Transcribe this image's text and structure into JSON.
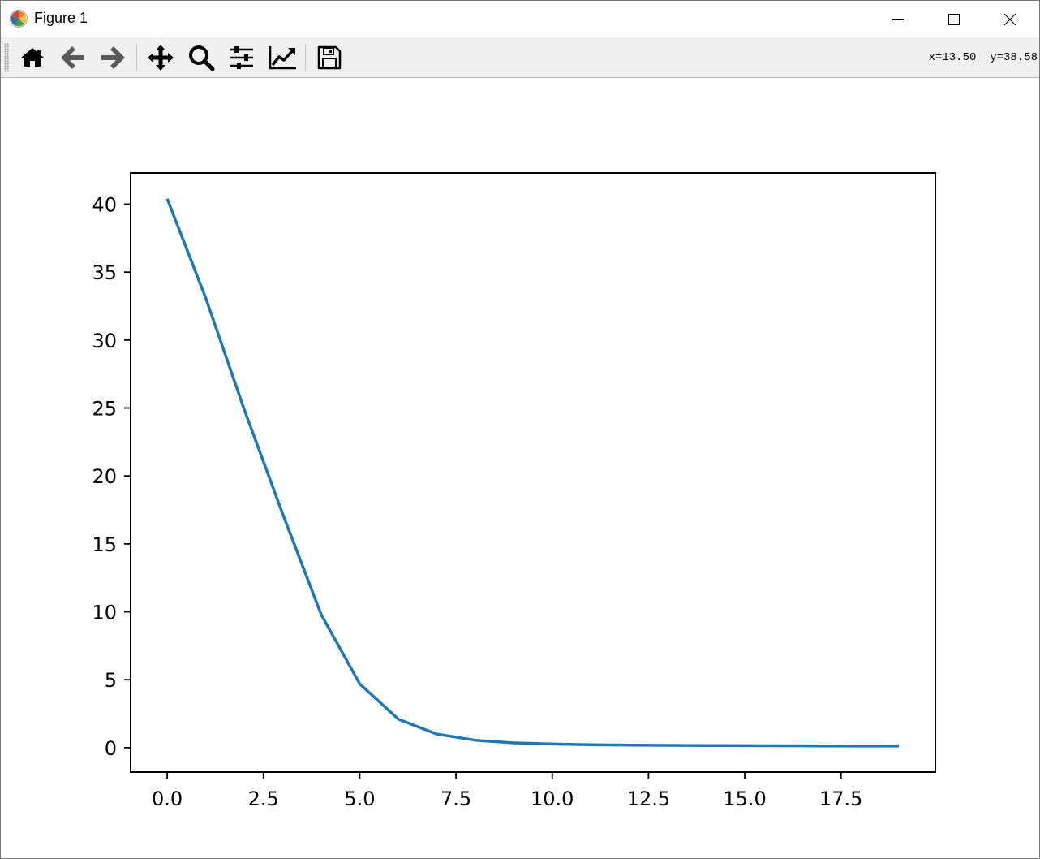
{
  "window": {
    "title": "Figure 1",
    "icon": "matplotlib-icon"
  },
  "window_controls": [
    "minimize-icon",
    "maximize-icon",
    "close-icon"
  ],
  "toolbar": {
    "buttons": [
      {
        "name": "home",
        "icon": "home-icon"
      },
      {
        "name": "back",
        "icon": "arrow-left-icon"
      },
      {
        "name": "forward",
        "icon": "arrow-right-icon"
      },
      {
        "name": "pan",
        "icon": "move-icon"
      },
      {
        "name": "zoom",
        "icon": "magnifier-icon"
      },
      {
        "name": "configure-subplots",
        "icon": "sliders-icon"
      },
      {
        "name": "edit-axis",
        "icon": "line-chart-icon"
      },
      {
        "name": "save",
        "icon": "floppy-disk-icon"
      }
    ],
    "coords": "x=13.50  y=38.58"
  },
  "colors": {
    "line": "#1f77b4",
    "toolbar_bg": "#f0f0f0"
  },
  "chart_data": {
    "type": "line",
    "title": "",
    "xlabel": "",
    "ylabel": "",
    "xlim": [
      -0.95,
      19.95
    ],
    "ylim": [
      -1.8,
      42.3
    ],
    "xticks": [
      0.0,
      2.5,
      5.0,
      7.5,
      10.0,
      12.5,
      15.0,
      17.5
    ],
    "xtick_labels": [
      "0.0",
      "2.5",
      "5.0",
      "7.5",
      "10.0",
      "12.5",
      "15.0",
      "17.5"
    ],
    "yticks": [
      0,
      5,
      10,
      15,
      20,
      25,
      30,
      35,
      40
    ],
    "ytick_labels": [
      "0",
      "5",
      "10",
      "15",
      "20",
      "25",
      "30",
      "35",
      "40"
    ],
    "grid": false,
    "series": [
      {
        "x": [
          0,
          1,
          2,
          3,
          4,
          5,
          6,
          7,
          8,
          9,
          10,
          11,
          12,
          13,
          14,
          15,
          16,
          17,
          18,
          19
        ],
        "y": [
          40.4,
          33.1,
          24.9,
          17.2,
          9.8,
          4.7,
          2.1,
          1.0,
          0.55,
          0.35,
          0.27,
          0.22,
          0.19,
          0.17,
          0.16,
          0.15,
          0.14,
          0.13,
          0.12,
          0.12
        ]
      }
    ]
  }
}
